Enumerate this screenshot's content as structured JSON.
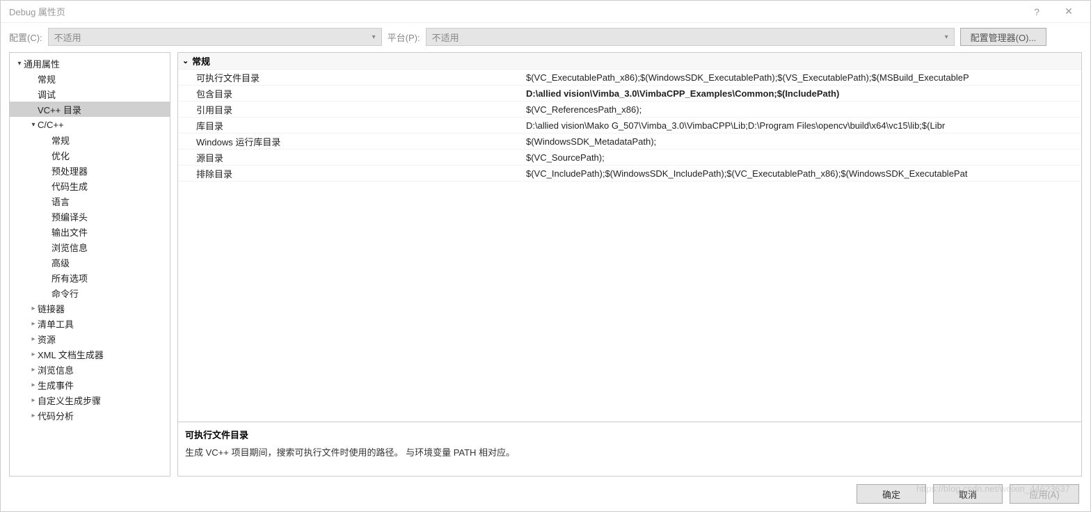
{
  "window": {
    "title": "Debug 属性页"
  },
  "toolbar": {
    "config_label": "配置(C):",
    "config_value": "不适用",
    "platform_label": "平台(P):",
    "platform_value": "不适用",
    "config_manager": "配置管理器(O)..."
  },
  "tree": [
    {
      "label": "通用属性",
      "depth": 0,
      "arrow": "open"
    },
    {
      "label": "常规",
      "depth": 1,
      "arrow": "none"
    },
    {
      "label": "调试",
      "depth": 1,
      "arrow": "none"
    },
    {
      "label": "VC++ 目录",
      "depth": 1,
      "arrow": "none",
      "selected": true
    },
    {
      "label": "C/C++",
      "depth": 1,
      "arrow": "open"
    },
    {
      "label": "常规",
      "depth": 2,
      "arrow": "none"
    },
    {
      "label": "优化",
      "depth": 2,
      "arrow": "none"
    },
    {
      "label": "预处理器",
      "depth": 2,
      "arrow": "none"
    },
    {
      "label": "代码生成",
      "depth": 2,
      "arrow": "none"
    },
    {
      "label": "语言",
      "depth": 2,
      "arrow": "none"
    },
    {
      "label": "预编译头",
      "depth": 2,
      "arrow": "none"
    },
    {
      "label": "输出文件",
      "depth": 2,
      "arrow": "none"
    },
    {
      "label": "浏览信息",
      "depth": 2,
      "arrow": "none"
    },
    {
      "label": "高级",
      "depth": 2,
      "arrow": "none"
    },
    {
      "label": "所有选项",
      "depth": 2,
      "arrow": "none"
    },
    {
      "label": "命令行",
      "depth": 2,
      "arrow": "none"
    },
    {
      "label": "链接器",
      "depth": 1,
      "arrow": "closed"
    },
    {
      "label": "清单工具",
      "depth": 1,
      "arrow": "closed"
    },
    {
      "label": "资源",
      "depth": 1,
      "arrow": "closed"
    },
    {
      "label": "XML 文档生成器",
      "depth": 1,
      "arrow": "closed"
    },
    {
      "label": "浏览信息",
      "depth": 1,
      "arrow": "closed"
    },
    {
      "label": "生成事件",
      "depth": 1,
      "arrow": "closed"
    },
    {
      "label": "自定义生成步骤",
      "depth": 1,
      "arrow": "closed"
    },
    {
      "label": "代码分析",
      "depth": 1,
      "arrow": "closed"
    }
  ],
  "grid": {
    "group": "常规",
    "rows": [
      {
        "label": "可执行文件目录",
        "value": "$(VC_ExecutablePath_x86);$(WindowsSDK_ExecutablePath);$(VS_ExecutablePath);$(MSBuild_ExecutableP"
      },
      {
        "label": "包含目录",
        "value": "D:\\allied vision\\Vimba_3.0\\VimbaCPP_Examples\\Common;$(IncludePath)",
        "bold": true
      },
      {
        "label": "引用目录",
        "value": "$(VC_ReferencesPath_x86);"
      },
      {
        "label": "库目录",
        "value": "D:\\allied vision\\Mako G_507\\Vimba_3.0\\VimbaCPP\\Lib;D:\\Program Files\\opencv\\build\\x64\\vc15\\lib;$(Libr"
      },
      {
        "label": "Windows 运行库目录",
        "value": "$(WindowsSDK_MetadataPath);"
      },
      {
        "label": "源目录",
        "value": "$(VC_SourcePath);"
      },
      {
        "label": "排除目录",
        "value": "$(VC_IncludePath);$(WindowsSDK_IncludePath);$(VC_ExecutablePath_x86);$(WindowsSDK_ExecutablePat"
      }
    ]
  },
  "description": {
    "title": "可执行文件目录",
    "text": "生成 VC++ 项目期间，搜索可执行文件时使用的路径。  与环境变量 PATH 相对应。"
  },
  "footer": {
    "ok": "确定",
    "cancel": "取消",
    "apply": "应用(A)"
  },
  "watermark": "https://blog.csdn.net/weixin_44623637"
}
